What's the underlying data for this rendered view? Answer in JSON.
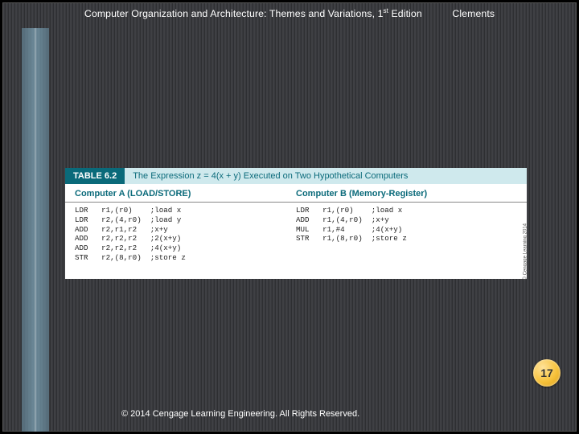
{
  "header": {
    "title_part1": "Computer Organization and Architecture: Themes and Variations, 1",
    "title_sup": "st",
    "title_part2": " Edition",
    "author": "Clements"
  },
  "table": {
    "tag": "TABLE 6.2",
    "caption": "The Expression z = 4(x + y) Executed on Two Hypothetical Computers",
    "colA_head": "Computer A (LOAD/STORE)",
    "colB_head": "Computer B (Memory-Register)",
    "colA_code": "LDR   r1,(r0)    ;load x\nLDR   r2,(4,r0)  ;load y\nADD   r2,r1,r2   ;x+y\nADD   r2,r2,r2   ;2(x+y)\nADD   r2,r2,r2   ;4(x+y)\nSTR   r2,(8,r0)  ;store z",
    "colB_code": "LDR   r1,(r0)    ;load x\nADD   r1,(4,r0)  ;x+y\nMUL   r1,#4      ;4(x+y)\nSTR   r1,(8,r0)  ;store z",
    "credit": "© Cengage Learning 2014"
  },
  "page_number": "17",
  "footer": "© 2014 Cengage Learning Engineering. All Rights Reserved."
}
